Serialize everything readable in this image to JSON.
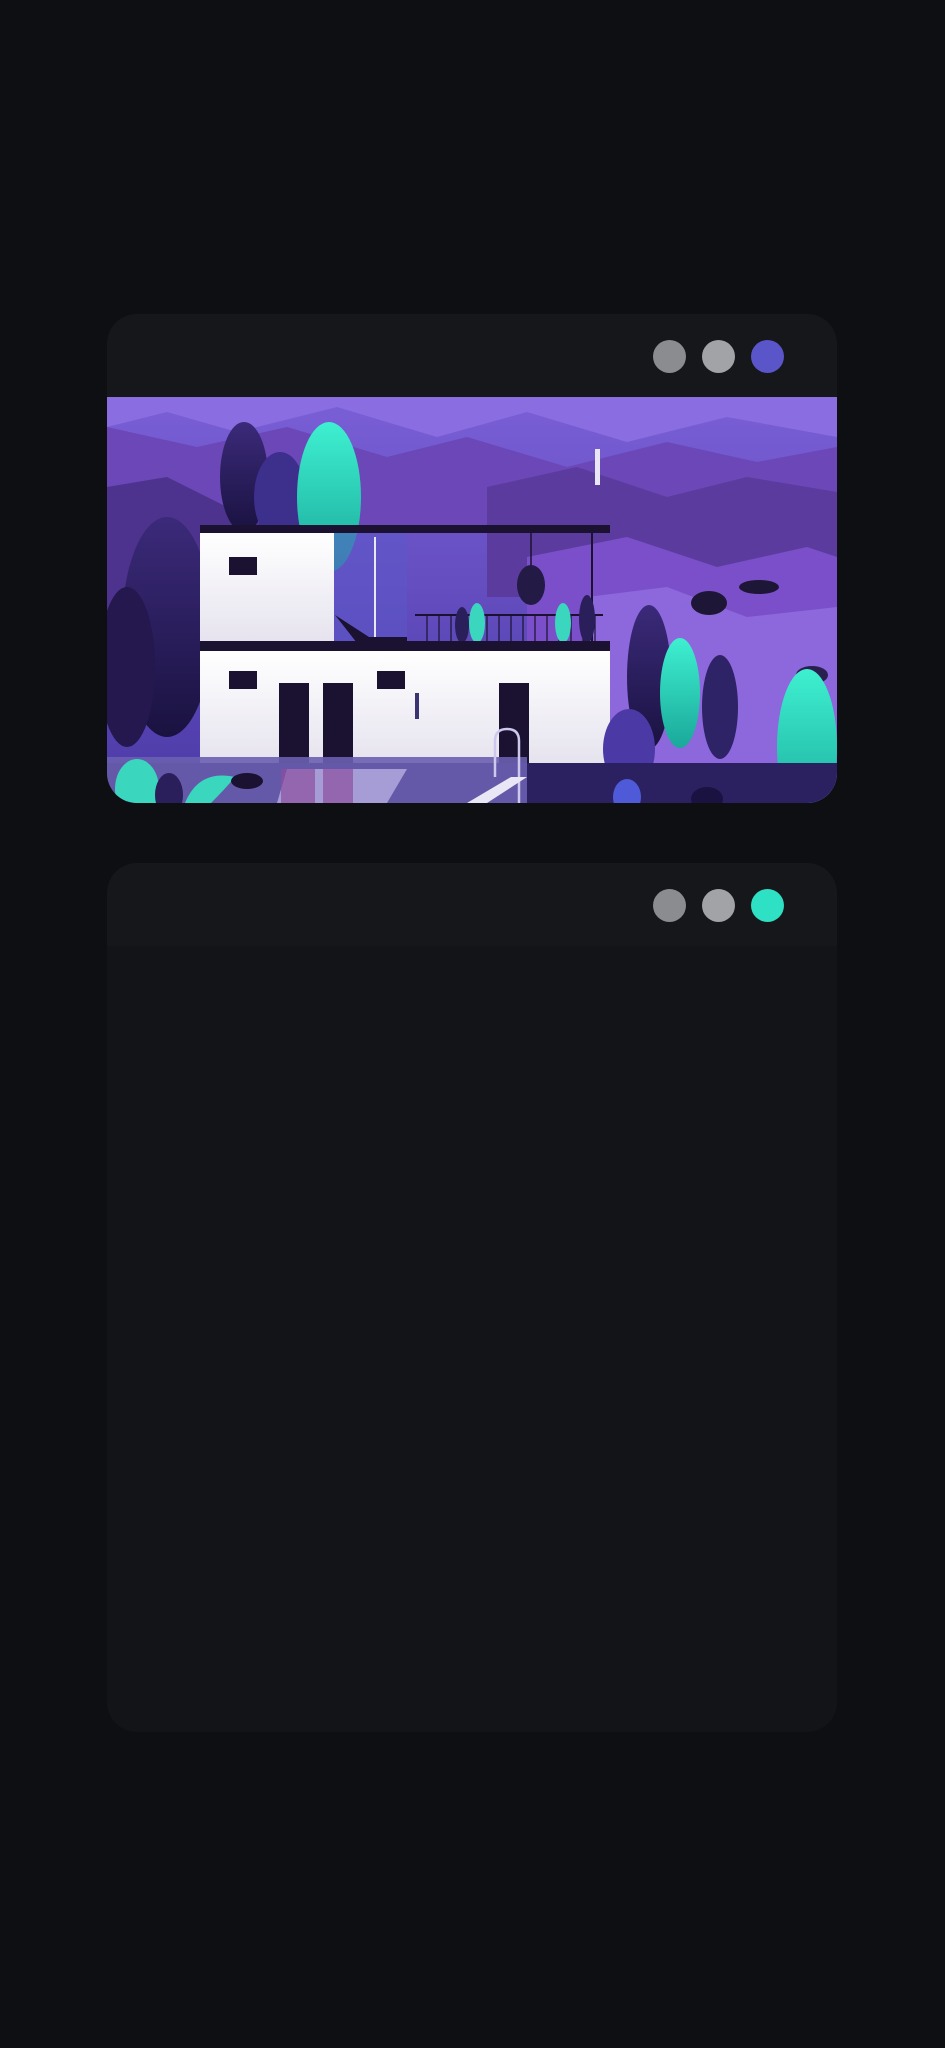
{
  "windows": [
    {
      "dots": [
        {
          "name": "dot-1",
          "color": "#8b8c90"
        },
        {
          "name": "dot-2",
          "color": "#a2a3a7"
        },
        {
          "name": "dot-3",
          "color": "#5a55c9"
        }
      ],
      "content": "illustration-modern-house-night-hills"
    },
    {
      "dots": [
        {
          "name": "dot-1",
          "color": "#8b8c90"
        },
        {
          "name": "dot-2",
          "color": "#a2a3a7"
        },
        {
          "name": "dot-3",
          "color": "#2ee0c4"
        }
      ],
      "content": "empty"
    }
  ],
  "colors": {
    "background": "#0e0f12",
    "window": "#16171b",
    "accent_purple": "#5a55c9",
    "accent_teal": "#2ee0c4"
  }
}
